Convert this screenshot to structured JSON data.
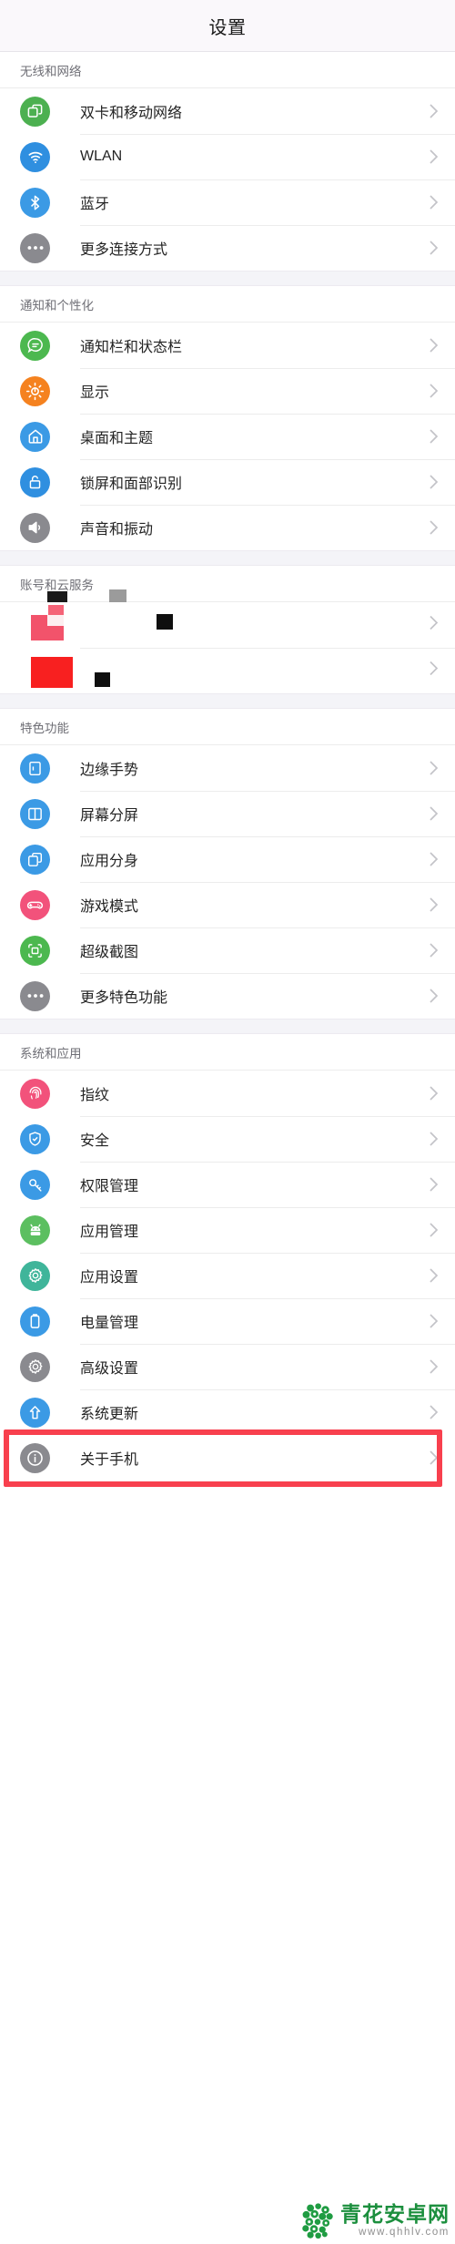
{
  "header": {
    "title": "设置"
  },
  "sections": [
    {
      "title": "无线和网络",
      "items": [
        {
          "label": "双卡和移动网络",
          "icon": "sim-card-icon",
          "color": "#4cb050"
        },
        {
          "label": "WLAN",
          "icon": "wifi-icon",
          "color": "#2f8fe0"
        },
        {
          "label": "蓝牙",
          "icon": "bluetooth-icon",
          "color": "#3b9ae5"
        },
        {
          "label": "更多连接方式",
          "icon": "ellipsis-icon",
          "color": "#8a8a8f"
        }
      ]
    },
    {
      "title": "通知和个性化",
      "items": [
        {
          "label": "通知栏和状态栏",
          "icon": "chat-bubble-icon",
          "color": "#4cb84f"
        },
        {
          "label": "显示",
          "icon": "brightness-icon",
          "color": "#f5821f"
        },
        {
          "label": "桌面和主题",
          "icon": "home-icon",
          "color": "#3b9ae5"
        },
        {
          "label": "锁屏和面部识别",
          "icon": "lock-icon",
          "color": "#2f8fe0"
        },
        {
          "label": "声音和振动",
          "icon": "speaker-icon",
          "color": "#8a8a8f"
        }
      ]
    },
    {
      "title": "账号和云服务",
      "redacted": true,
      "items": [
        {
          "label": "",
          "icon": "redacted-icon",
          "color": "#f2527b"
        },
        {
          "label": "",
          "icon": "redacted-icon",
          "color": "#f82020"
        }
      ]
    },
    {
      "title": "特色功能",
      "items": [
        {
          "label": "边缘手势",
          "icon": "edge-gesture-icon",
          "color": "#3b9ae5"
        },
        {
          "label": "屏幕分屏",
          "icon": "split-screen-icon",
          "color": "#3b9ae5"
        },
        {
          "label": "应用分身",
          "icon": "app-clone-icon",
          "color": "#3b9ae5"
        },
        {
          "label": "游戏模式",
          "icon": "gamepad-icon",
          "color": "#f2527b"
        },
        {
          "label": "超级截图",
          "icon": "screenshot-icon",
          "color": "#4cb84f"
        },
        {
          "label": "更多特色功能",
          "icon": "ellipsis-icon",
          "color": "#8a8a8f"
        }
      ]
    },
    {
      "title": "系统和应用",
      "items": [
        {
          "label": "指纹",
          "icon": "fingerprint-icon",
          "color": "#f2527b"
        },
        {
          "label": "安全",
          "icon": "shield-icon",
          "color": "#3b9ae5"
        },
        {
          "label": "权限管理",
          "icon": "key-icon",
          "color": "#3b9ae5"
        },
        {
          "label": "应用管理",
          "icon": "android-icon",
          "color": "#5cbf60"
        },
        {
          "label": "应用设置",
          "icon": "gear-icon",
          "color": "#3fb59a"
        },
        {
          "label": "电量管理",
          "icon": "battery-icon",
          "color": "#3b9ae5"
        },
        {
          "label": "高级设置",
          "icon": "gear-icon",
          "color": "#8a8a8f"
        },
        {
          "label": "系统更新",
          "icon": "up-arrow-icon",
          "color": "#3b9ae5"
        },
        {
          "label": "关于手机",
          "icon": "info-icon",
          "color": "#8a8a8f",
          "highlighted": true
        }
      ]
    }
  ],
  "highlight": {
    "color": "#f8404e"
  },
  "watermark": {
    "title": "青花安卓网",
    "url": "www.qhhlv.com",
    "color": "#1c8f3e"
  }
}
